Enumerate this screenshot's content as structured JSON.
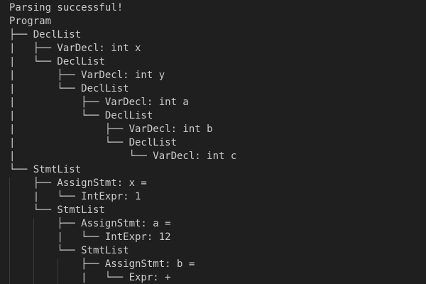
{
  "terminal": {
    "lines": [
      "Parsing successful!",
      "Program",
      "├── DeclList",
      "|   ├── VarDecl: int x",
      "|   └── DeclList",
      "|       ├── VarDecl: int y",
      "|       └── DeclList",
      "|           ├── VarDecl: int a",
      "|           └── DeclList",
      "|               ├── VarDecl: int b",
      "|               └── DeclList",
      "|                   └── VarDecl: int c",
      "└── StmtList",
      "    ├── AssignStmt: x =",
      "    |   └── IntExpr: 1",
      "    └── StmtList",
      "        ├── AssignStmt: a =",
      "        |   └── IntExpr: 12",
      "        └── StmtList",
      "            ├── AssignStmt: b =",
      "            |   └── Expr: +"
    ]
  },
  "colors": {
    "background": "#1f1f1f",
    "text": "#cccccc",
    "indent_guide": "#3a3a3a"
  }
}
